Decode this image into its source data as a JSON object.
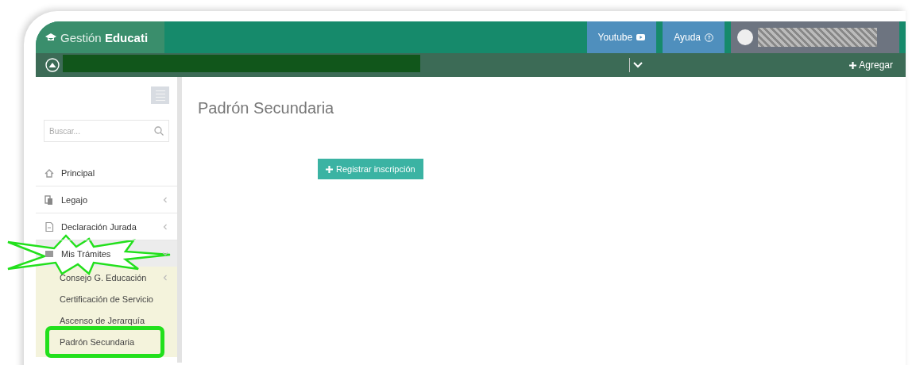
{
  "header": {
    "brand_light": "Gestión",
    "brand_bold": "Educati",
    "buttons": [
      "Youtube",
      "Ayuda"
    ],
    "add_label": "Agregar"
  },
  "sidebar": {
    "search_placeholder": "Buscar...",
    "items": [
      {
        "label": "Principal"
      },
      {
        "label": "Legajo",
        "expanded": false
      },
      {
        "label": "Declaración Jurada",
        "expanded": false
      },
      {
        "label": "Mis Trámites",
        "expanded": true,
        "kind": "starburst",
        "children": [
          {
            "label": "Consejo G. Educación",
            "expanded": false
          },
          {
            "label": "Certificación de Servicio"
          },
          {
            "label": "Ascenso de Jerarquía"
          },
          {
            "label": "Padrón Secundaria",
            "kind": "framed"
          }
        ]
      }
    ]
  },
  "main": {
    "title": "Padrón Secundaria",
    "button": "Registrar inscripción"
  }
}
